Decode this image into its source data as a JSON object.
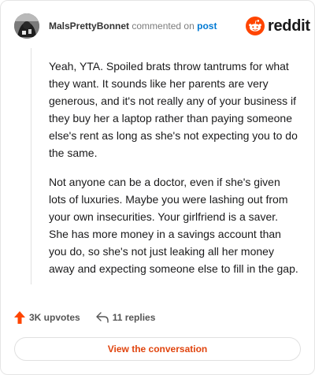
{
  "header": {
    "username": "MalsPrettyBonnet",
    "verb": "commented on",
    "target": "post"
  },
  "brand": {
    "wordmark": "reddit",
    "color": "#ff4500"
  },
  "comment": {
    "paragraphs": [
      "Yeah, YTA. Spoiled brats throw tantrums for what they want. It sounds like her parents are very generous, and it's not really any of your business if they buy her a laptop rather than paying someone else's rent as long as she's not expecting you to do the same.",
      "Not anyone can be a doctor, even if she's given lots of luxuries. Maybe you were lashing out from your own insecurities. Your girlfriend is a saver. She has more money in a savings account than you do, so she's not just leaking all her money away and expecting someone else to fill in the gap."
    ]
  },
  "actions": {
    "upvotes_label": "3K upvotes",
    "replies_label": "11 replies"
  },
  "cta": {
    "label": "View the conversation"
  },
  "icons": [
    "avatar",
    "reddit-snoo-icon",
    "upvote-arrow-icon",
    "reply-arrow-icon"
  ]
}
